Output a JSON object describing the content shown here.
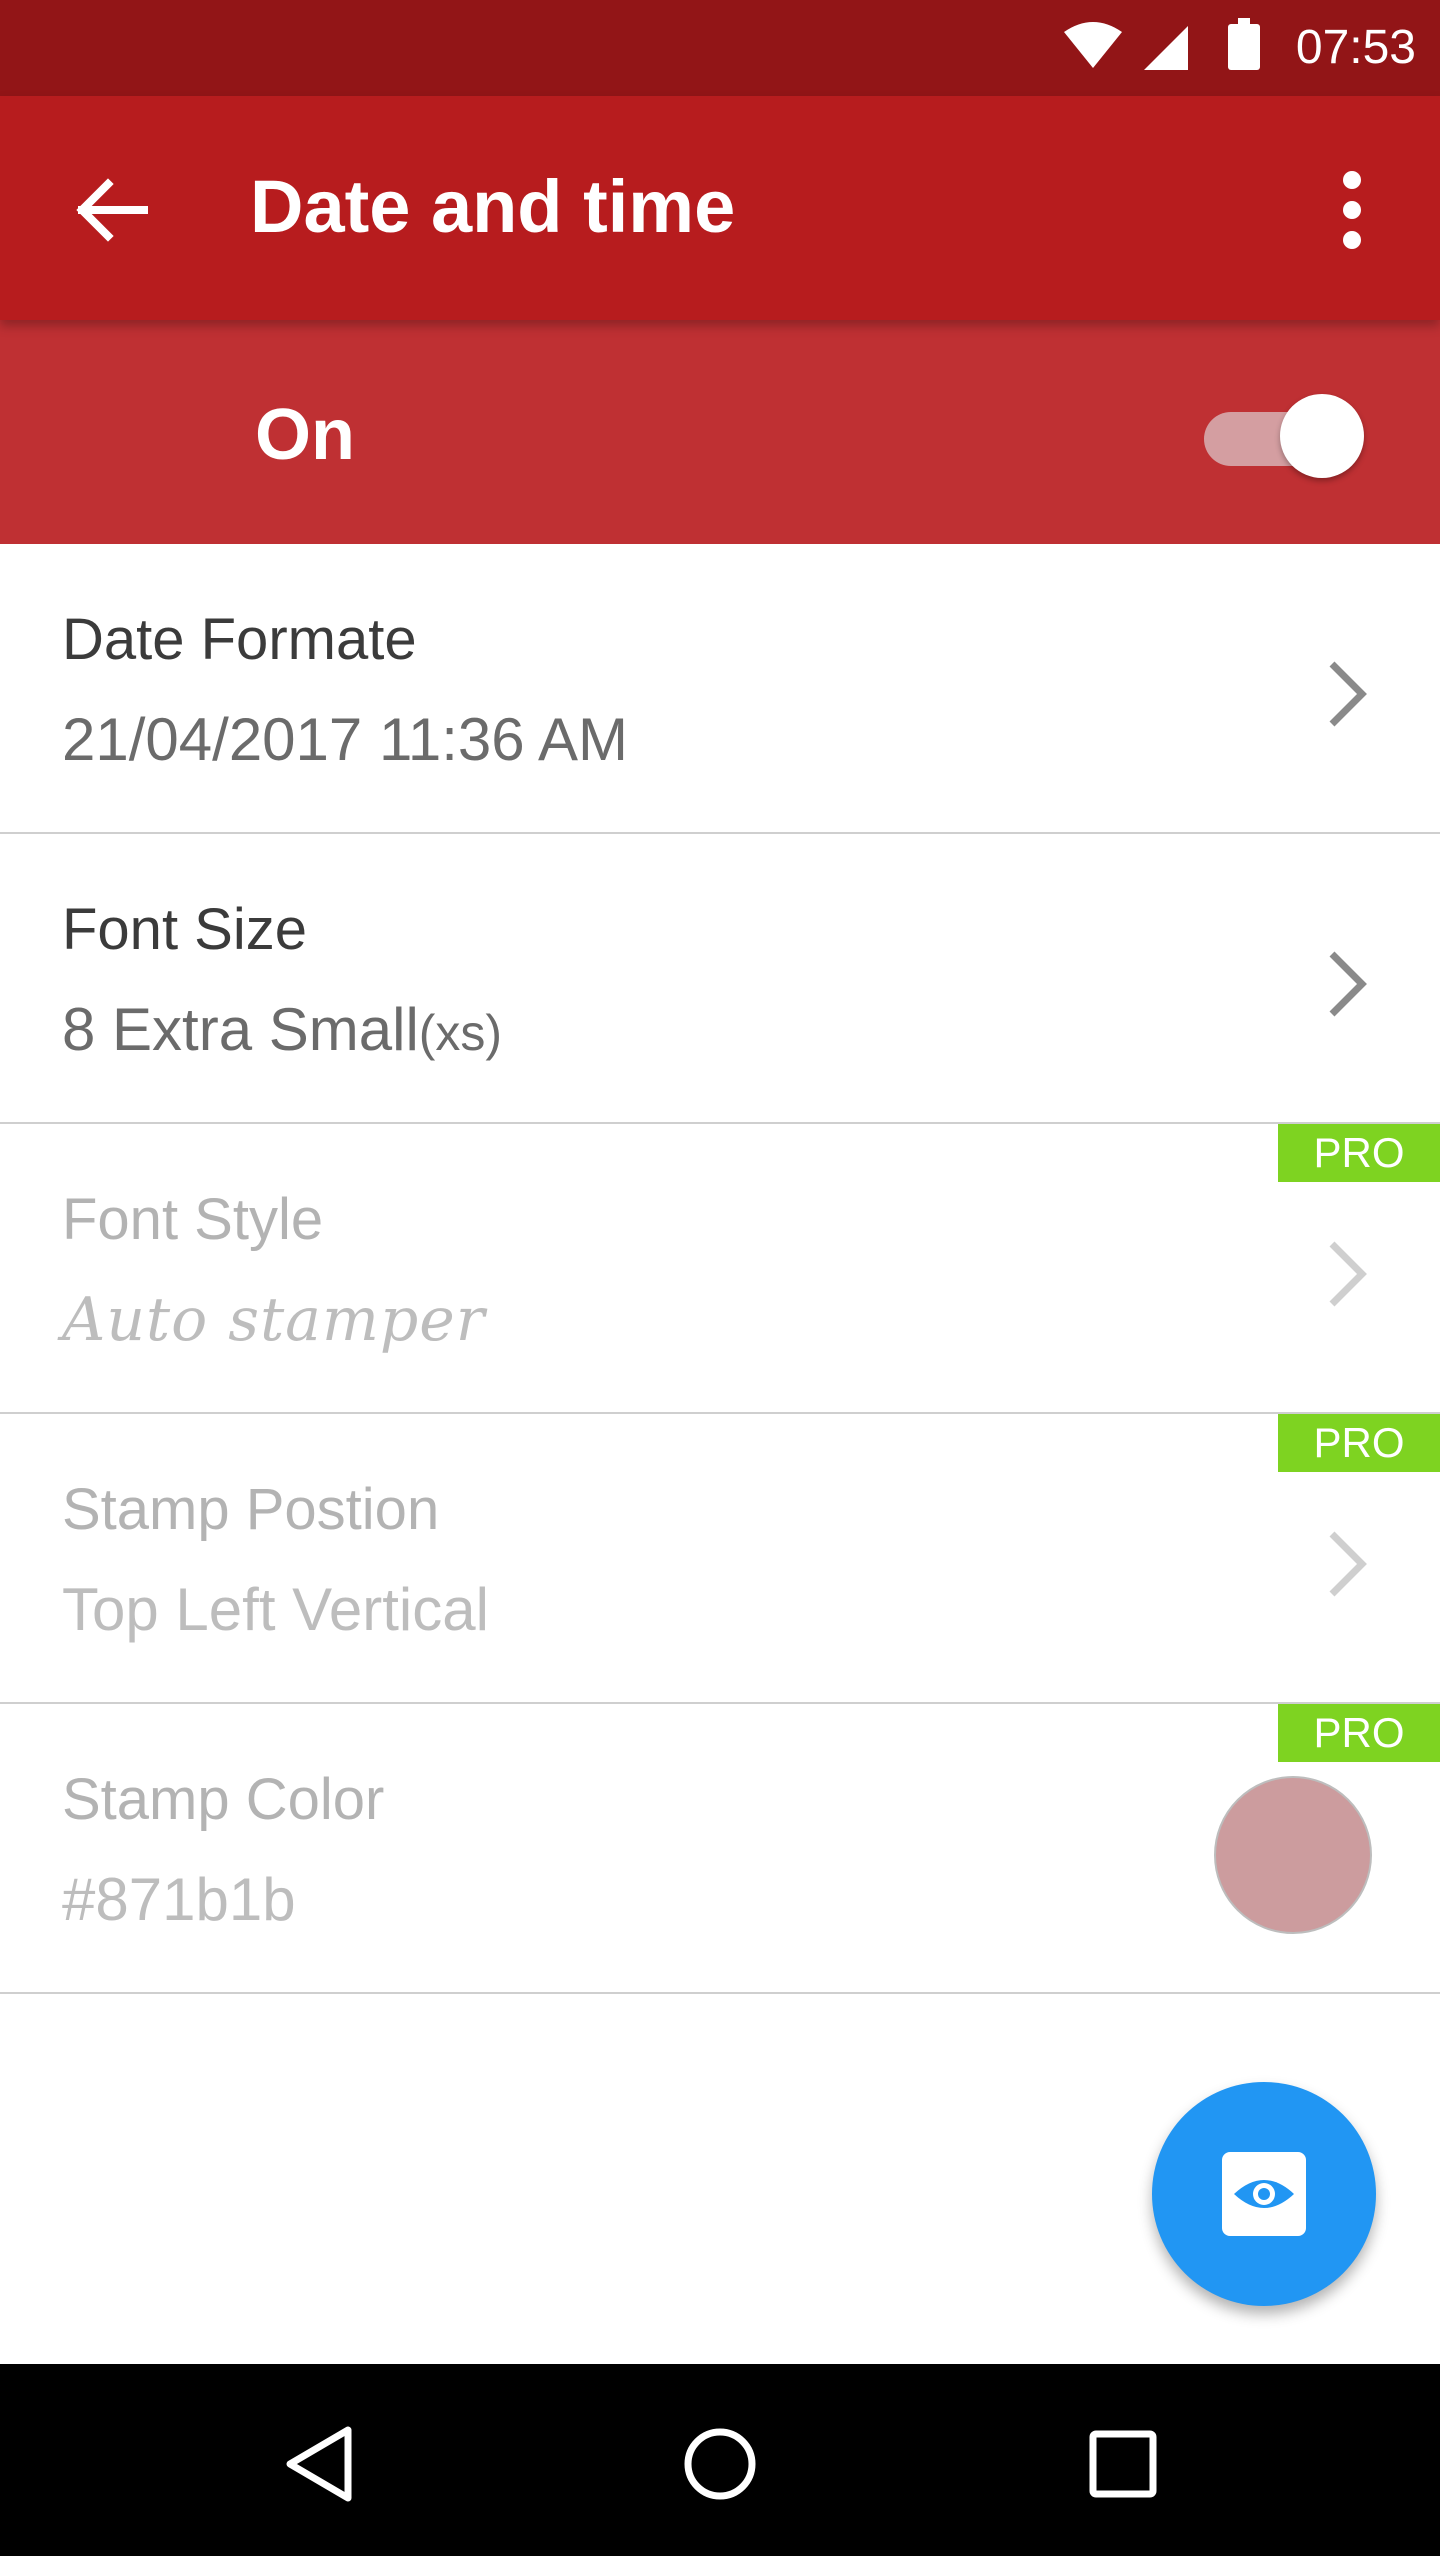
{
  "status_bar": {
    "time": "07:53",
    "icons": [
      "wifi-icon",
      "signal-icon",
      "battery-icon"
    ]
  },
  "app_bar": {
    "title": "Date and time",
    "back_icon": "arrow-back-icon",
    "menu_icon": "more-vert-icon"
  },
  "master_switch": {
    "label": "On",
    "enabled": true
  },
  "settings": [
    {
      "title": "Date Formate",
      "value": "21/04/2017  11:36 AM",
      "pro": false
    },
    {
      "title": "Font Size",
      "value_main": "8  Extra Small",
      "value_suffix": "(xs)",
      "pro": false
    },
    {
      "title": "Font Style",
      "value": "Auto stamper",
      "pro": true,
      "badge": "PRO"
    },
    {
      "title": "Stamp Postion",
      "value": "Top Left Vertical",
      "pro": true,
      "badge": "PRO"
    },
    {
      "title": "Stamp Color",
      "value": "#871b1b",
      "pro": true,
      "badge": "PRO",
      "swatch_color": "#cc9c9e"
    }
  ],
  "fab": {
    "icon": "eye-icon",
    "color": "#2196f3"
  },
  "nav_bar": {
    "icons": [
      "back-triangle-icon",
      "home-circle-icon",
      "recents-square-icon"
    ]
  },
  "colors": {
    "status_bar": "#921517",
    "app_bar": "#b71c1e",
    "switch_bar": "#bf3033",
    "pro_badge": "#7ed321"
  }
}
